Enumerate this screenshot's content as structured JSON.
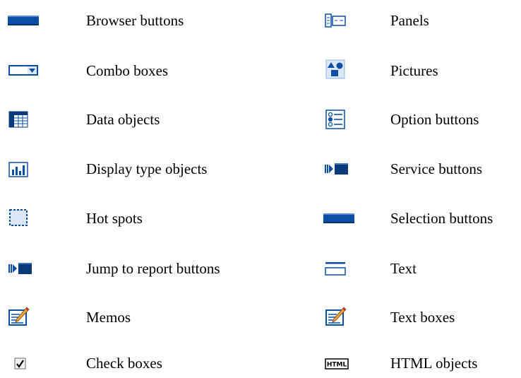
{
  "colors": {
    "accent_blue": "#0a4fa3",
    "dark_blue": "#0a3a7a",
    "light_blue": "#bcd3ee",
    "pale_blue": "#e7eff9",
    "ink": "#000000"
  },
  "left_column": [
    {
      "label": "Browser buttons",
      "icon": "browser-button-icon"
    },
    {
      "label": "Combo boxes",
      "icon": "combo-box-icon"
    },
    {
      "label": "Data objects",
      "icon": "data-grid-icon"
    },
    {
      "label": "Display type objects",
      "icon": "bar-chart-icon"
    },
    {
      "label": "Hot spots",
      "icon": "hot-spot-icon"
    },
    {
      "label": "Jump to report buttons",
      "icon": "jump-button-icon"
    },
    {
      "label": "Memos",
      "icon": "memo-pencil-icon"
    },
    {
      "label": "Check boxes",
      "icon": "checkbox-icon"
    }
  ],
  "right_column": [
    {
      "label": "Panels",
      "icon": "panels-icon"
    },
    {
      "label": "Pictures",
      "icon": "pictures-icon"
    },
    {
      "label": "Option buttons",
      "icon": "option-buttons-icon"
    },
    {
      "label": "Service buttons",
      "icon": "service-button-icon"
    },
    {
      "label": "Selection buttons",
      "icon": "selection-button-icon"
    },
    {
      "label": "Text",
      "icon": "text-icon"
    },
    {
      "label": "Text boxes",
      "icon": "text-box-pencil-icon"
    },
    {
      "label": "HTML objects",
      "icon": "html-icon"
    }
  ]
}
